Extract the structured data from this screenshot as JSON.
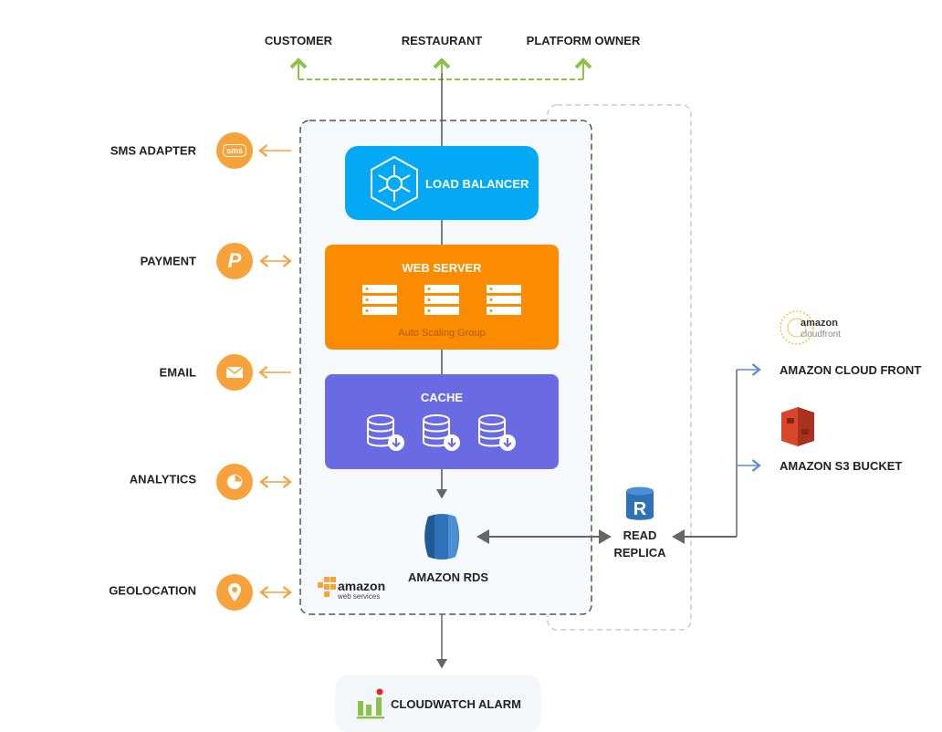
{
  "top_labels": {
    "customer": "CUSTOMER",
    "restaurant": "RESTAURANT",
    "platform_owner": "PLATFORM OWNER"
  },
  "left_services": [
    {
      "label": "SMS ADAPTER",
      "icon": "sms-icon",
      "icon_text": "sms"
    },
    {
      "label": "PAYMENT",
      "icon": "paypal-icon",
      "icon_text": "P"
    },
    {
      "label": "EMAIL",
      "icon": "envelope-icon"
    },
    {
      "label": "ANALYTICS",
      "icon": "pie-chart-icon"
    },
    {
      "label": "GEOLOCATION",
      "icon": "map-pin-icon"
    }
  ],
  "load_balancer": {
    "label": "LOAD BALANCER"
  },
  "web_server": {
    "label": "WEB SERVER",
    "sublabel": "Auto Scaling Group"
  },
  "cache": {
    "label": "CACHE"
  },
  "rds": {
    "label": "AMAZON RDS"
  },
  "read_replica": {
    "line1": "READ",
    "line2": "REPLICA",
    "icon_letter": "R"
  },
  "aws_logo": {
    "text1": "amazon",
    "text2": "web services"
  },
  "cloudfront": {
    "logo1": "amazon",
    "logo2": "cloudfront",
    "label": "AMAZON CLOUD FRONT"
  },
  "s3": {
    "label": "AMAZON S3 BUCKET"
  },
  "cloudwatch": {
    "label": "CLOUDWATCH ALARM"
  },
  "colors": {
    "load_balancer": "#03A9F4",
    "web_server": "#FB8C00",
    "cache": "#6A6AE3",
    "service_icon": "#F7A23B",
    "user_arrows": "#8BC34A",
    "cdn_arrows": "#5B8DD9",
    "rds": "#2E73B8",
    "s3": "#D9472B"
  }
}
